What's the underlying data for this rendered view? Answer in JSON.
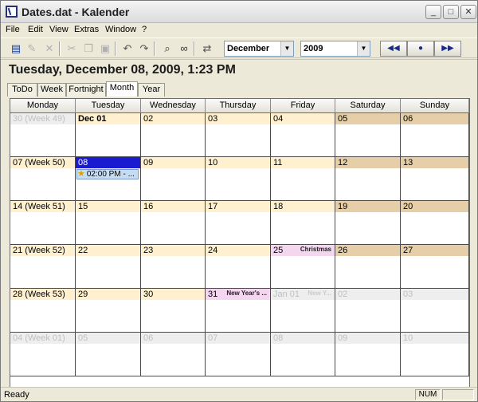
{
  "window": {
    "title": "Dates.dat - Kalender",
    "minimize_glyph": "_",
    "maximize_glyph": "□",
    "close_glyph": "✕"
  },
  "menu": [
    "File",
    "Edit",
    "View",
    "Extras",
    "Window",
    "?"
  ],
  "toolbar": {
    "month_value": "December",
    "year_value": "2009",
    "prev_glyph": "◀◀",
    "today_glyph": "●",
    "next_glyph": "▶▶",
    "icons": [
      "new-entry-icon",
      "edit-icon",
      "delete-icon",
      "cut-icon",
      "copy-icon",
      "paste-icon",
      "undo-icon",
      "redo-icon",
      "find-icon",
      "binoculars-icon",
      "swap-icon"
    ]
  },
  "date_header": "Tuesday, December 08, 2009, 1:23 PM",
  "tabs": [
    "ToDo",
    "Week",
    "Fortnight",
    "Month",
    "Year"
  ],
  "active_tab": "Month",
  "calendar": {
    "weekdays": [
      "Monday",
      "Tuesday",
      "Wednesday",
      "Thursday",
      "Friday",
      "Saturday",
      "Sunday"
    ],
    "weeks": [
      [
        {
          "label": "30 (Week 49)",
          "kind": "other"
        },
        {
          "label": "Dec 01",
          "kind": "week",
          "bold": true
        },
        {
          "label": "02",
          "kind": "week"
        },
        {
          "label": "03",
          "kind": "week"
        },
        {
          "label": "04",
          "kind": "week"
        },
        {
          "label": "05",
          "kind": "weekend"
        },
        {
          "label": "06",
          "kind": "weekend"
        }
      ],
      [
        {
          "label": "07 (Week 50)",
          "kind": "week"
        },
        {
          "label": "08",
          "kind": "today",
          "appointment": "02:00 PM - ..."
        },
        {
          "label": "09",
          "kind": "week"
        },
        {
          "label": "10",
          "kind": "week"
        },
        {
          "label": "11",
          "kind": "week"
        },
        {
          "label": "12",
          "kind": "weekend"
        },
        {
          "label": "13",
          "kind": "weekend"
        }
      ],
      [
        {
          "label": "14 (Week 51)",
          "kind": "week"
        },
        {
          "label": "15",
          "kind": "week"
        },
        {
          "label": "16",
          "kind": "week"
        },
        {
          "label": "17",
          "kind": "week"
        },
        {
          "label": "18",
          "kind": "week"
        },
        {
          "label": "19",
          "kind": "weekend"
        },
        {
          "label": "20",
          "kind": "weekend"
        }
      ],
      [
        {
          "label": "21 (Week 52)",
          "kind": "week"
        },
        {
          "label": "22",
          "kind": "week"
        },
        {
          "label": "23",
          "kind": "week"
        },
        {
          "label": "24",
          "kind": "week"
        },
        {
          "label": "25",
          "kind": "holiday",
          "holiday": "Christmas"
        },
        {
          "label": "26",
          "kind": "weekend"
        },
        {
          "label": "27",
          "kind": "weekend"
        }
      ],
      [
        {
          "label": "28 (Week 53)",
          "kind": "week"
        },
        {
          "label": "29",
          "kind": "week"
        },
        {
          "label": "30",
          "kind": "week"
        },
        {
          "label": "31",
          "kind": "holiday",
          "holiday": "New Year's ..."
        },
        {
          "label": "Jan 01",
          "kind": "other",
          "holiday": "New Y...",
          "holiday_faded": true
        },
        {
          "label": "02",
          "kind": "other"
        },
        {
          "label": "03",
          "kind": "other"
        }
      ],
      [
        {
          "label": "04 (Week 01)",
          "kind": "other"
        },
        {
          "label": "05",
          "kind": "other"
        },
        {
          "label": "06",
          "kind": "other"
        },
        {
          "label": "07",
          "kind": "other"
        },
        {
          "label": "08",
          "kind": "other"
        },
        {
          "label": "09",
          "kind": "other"
        },
        {
          "label": "10",
          "kind": "other"
        }
      ]
    ]
  },
  "status": {
    "text": "Ready",
    "num": "NUM"
  }
}
